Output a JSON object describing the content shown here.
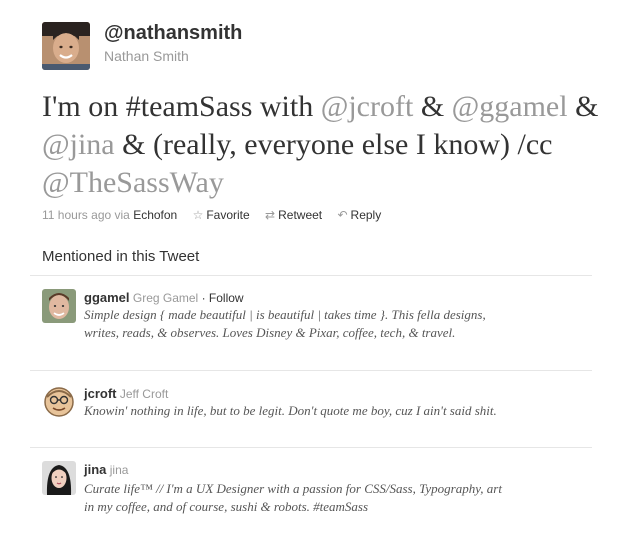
{
  "tweet": {
    "handle": "@nathansmith",
    "name": "Nathan Smith",
    "text": {
      "p1": "I'm on #teamSass with ",
      "m1": "@jcroft",
      "p2": " & ",
      "m2": "@ggamel",
      "p3": " & ",
      "m3": "@jina",
      "p4": " & (really, everyone else I know) /cc ",
      "m4": "@TheSassWay"
    },
    "time": "11 hours ago via",
    "client": "Echofon",
    "actions": {
      "favorite": "Favorite",
      "retweet": "Retweet",
      "reply": "Reply"
    },
    "icons": {
      "favorite": "star-icon",
      "retweet": "retweet-icon",
      "reply": "reply-icon"
    }
  },
  "mentioned": {
    "title": "Mentioned in this Tweet",
    "users": [
      {
        "username": "ggamel",
        "name": "Greg Gamel",
        "follow": "· Follow",
        "bio": "Simple design { made beautiful | is beautiful | takes time }. This fella designs, writes, reads, & observes. Loves Disney & Pixar, coffee, tech, & travel."
      },
      {
        "username": "jcroft",
        "name": "Jeff Croft",
        "bio": "Knowin' nothing in life, but to be legit. Don't quote me boy, cuz I ain't said shit."
      },
      {
        "username": "jina",
        "name": "jina",
        "bio": "Curate life™ // I'm a UX Designer with a passion for CSS/Sass, Typography, art in my coffee, and of course, sushi & robots. #teamSass"
      }
    ]
  },
  "colors": {
    "muted": "#999999",
    "text": "#333333",
    "divider": "#e6e6e6"
  }
}
